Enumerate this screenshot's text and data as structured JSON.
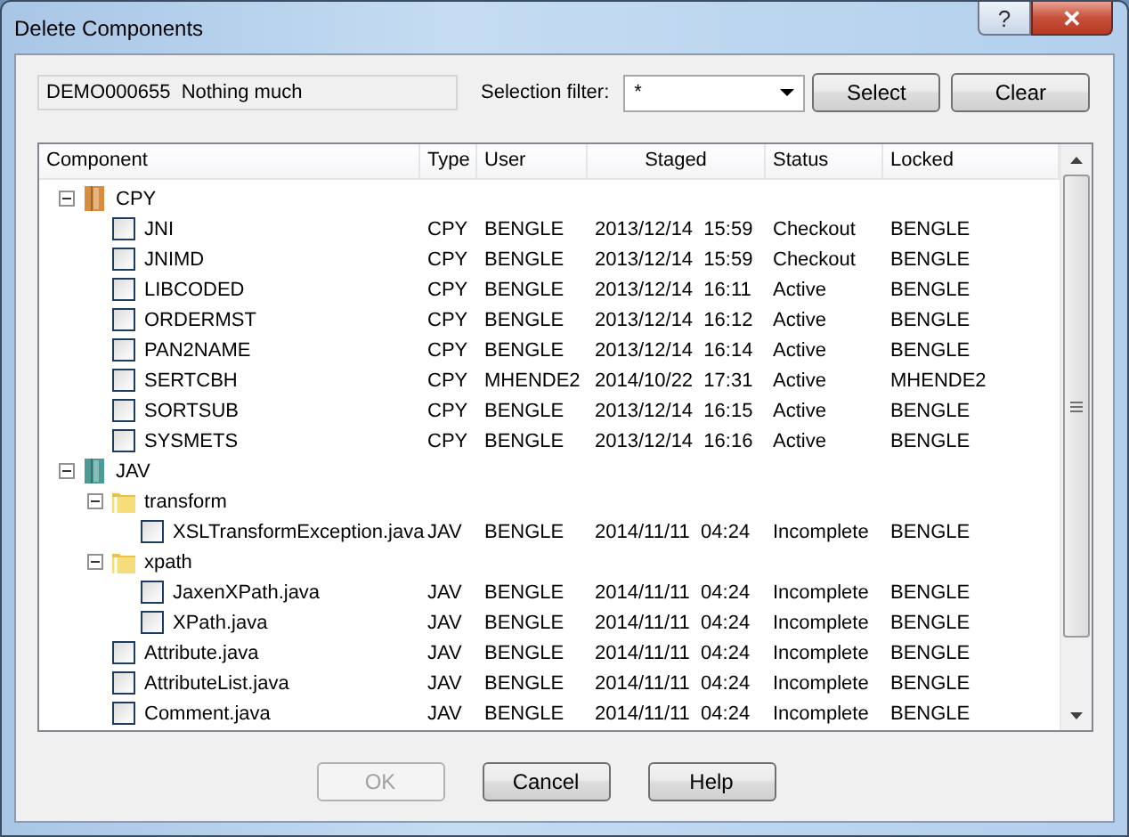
{
  "window": {
    "title": "Delete Components",
    "help_button": "?",
    "close_button": "✕"
  },
  "info_field": {
    "value": "DEMO000655  Nothing much"
  },
  "selection_filter": {
    "label": "Selection filter:",
    "value": "*"
  },
  "top_buttons": [
    {
      "label": "Select",
      "disabled": false
    },
    {
      "label": "Clear",
      "disabled": false
    }
  ],
  "table": {
    "columns": [
      "Component",
      "Type",
      "User",
      "Staged",
      "Status",
      "Locked"
    ],
    "rows": [
      {
        "kind": "library",
        "name": "CPY",
        "color": "#d98c3c",
        "expanded": true,
        "children": [
          {
            "kind": "component",
            "name": "JNI",
            "checked": false,
            "type": "CPY",
            "user": "BENGLE",
            "staged": "2013/12/14  15:59",
            "status": "Checkout",
            "locked": "BENGLE"
          },
          {
            "kind": "component",
            "name": "JNIMD",
            "checked": false,
            "type": "CPY",
            "user": "BENGLE",
            "staged": "2013/12/14  15:59",
            "status": "Checkout",
            "locked": "BENGLE"
          },
          {
            "kind": "component",
            "name": "LIBCODED",
            "checked": false,
            "type": "CPY",
            "user": "BENGLE",
            "staged": "2013/12/14  16:11",
            "status": "Active",
            "locked": "BENGLE"
          },
          {
            "kind": "component",
            "name": "ORDERMST",
            "checked": false,
            "type": "CPY",
            "user": "BENGLE",
            "staged": "2013/12/14  16:12",
            "status": "Active",
            "locked": "BENGLE"
          },
          {
            "kind": "component",
            "name": "PAN2NAME",
            "checked": false,
            "type": "CPY",
            "user": "BENGLE",
            "staged": "2013/12/14  16:14",
            "status": "Active",
            "locked": "BENGLE"
          },
          {
            "kind": "component",
            "name": "SERTCBH",
            "checked": false,
            "type": "CPY",
            "user": "MHENDE2",
            "staged": "2014/10/22  17:31",
            "status": "Active",
            "locked": "MHENDE2"
          },
          {
            "kind": "component",
            "name": "SORTSUB",
            "checked": false,
            "type": "CPY",
            "user": "BENGLE",
            "staged": "2013/12/14  16:15",
            "status": "Active",
            "locked": "BENGLE"
          },
          {
            "kind": "component",
            "name": "SYSMETS",
            "checked": false,
            "type": "CPY",
            "user": "BENGLE",
            "staged": "2013/12/14  16:16",
            "status": "Active",
            "locked": "BENGLE"
          }
        ]
      },
      {
        "kind": "library",
        "name": "JAV",
        "color": "#4a9a96",
        "expanded": true,
        "children": [
          {
            "kind": "folder",
            "name": "transform",
            "expanded": true,
            "children": [
              {
                "kind": "component",
                "name": "XSLTransformException.java",
                "checked": false,
                "type": "JAV",
                "user": "BENGLE",
                "staged": "2014/11/11  04:24",
                "status": "Incomplete",
                "locked": "BENGLE"
              }
            ]
          },
          {
            "kind": "folder",
            "name": "xpath",
            "expanded": true,
            "children": [
              {
                "kind": "component",
                "name": "JaxenXPath.java",
                "checked": false,
                "type": "JAV",
                "user": "BENGLE",
                "staged": "2014/11/11  04:24",
                "status": "Incomplete",
                "locked": "BENGLE"
              },
              {
                "kind": "component",
                "name": "XPath.java",
                "checked": false,
                "type": "JAV",
                "user": "BENGLE",
                "staged": "2014/11/11  04:24",
                "status": "Incomplete",
                "locked": "BENGLE"
              }
            ]
          },
          {
            "kind": "component",
            "name": "Attribute.java",
            "checked": false,
            "type": "JAV",
            "user": "BENGLE",
            "staged": "2014/11/11  04:24",
            "status": "Incomplete",
            "locked": "BENGLE"
          },
          {
            "kind": "component",
            "name": "AttributeList.java",
            "checked": false,
            "type": "JAV",
            "user": "BENGLE",
            "staged": "2014/11/11  04:24",
            "status": "Incomplete",
            "locked": "BENGLE"
          },
          {
            "kind": "component",
            "name": "Comment.java",
            "checked": false,
            "type": "JAV",
            "user": "BENGLE",
            "staged": "2014/11/11  04:24",
            "status": "Incomplete",
            "locked": "BENGLE"
          }
        ]
      }
    ]
  },
  "buttons": [
    {
      "label": "OK",
      "disabled": true
    },
    {
      "label": "Cancel",
      "disabled": false
    },
    {
      "label": "Help",
      "disabled": false
    }
  ]
}
